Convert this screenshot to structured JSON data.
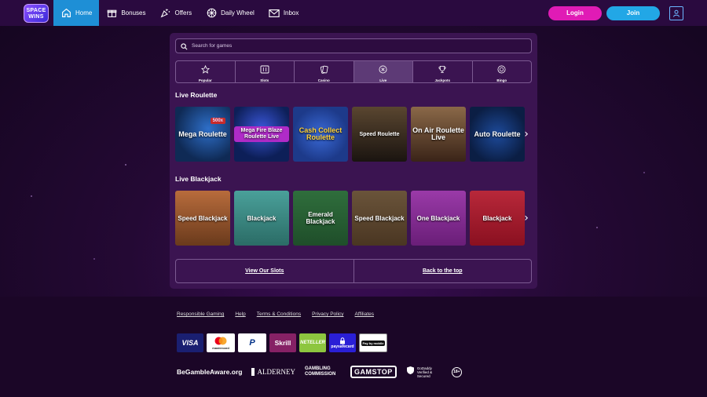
{
  "header": {
    "logo_text": "SPACE WINS",
    "nav": [
      {
        "label": "Home",
        "icon": "home-icon",
        "active": true
      },
      {
        "label": "Bonuses",
        "icon": "gift-icon",
        "active": false
      },
      {
        "label": "Offers",
        "icon": "party-popper-icon",
        "active": false
      },
      {
        "label": "Daily Wheel",
        "icon": "wheel-icon",
        "active": false
      },
      {
        "label": "Inbox",
        "icon": "mail-icon",
        "active": false
      }
    ],
    "login_label": "Login",
    "join_label": "Join"
  },
  "search": {
    "placeholder": "Search for games"
  },
  "categories": [
    {
      "label": "Popular",
      "icon": "star-icon",
      "active": false
    },
    {
      "label": "Slots",
      "icon": "slot-machine-icon",
      "active": false
    },
    {
      "label": "Casino",
      "icon": "cards-icon",
      "active": false
    },
    {
      "label": "Live",
      "icon": "live-chip-icon",
      "active": true
    },
    {
      "label": "Jackpots",
      "icon": "trophy-icon",
      "active": false
    },
    {
      "label": "Bingo",
      "icon": "bingo-ball-icon",
      "active": false
    }
  ],
  "sections": [
    {
      "title": "Live Roulette",
      "games": [
        {
          "name": "Mega Roulette",
          "badge": "500x",
          "color": "#0f2a55"
        },
        {
          "name": "Mega Fire Blaze Roulette Live",
          "color": "#0d1f58"
        },
        {
          "name": "Cash Collect Roulette",
          "color": "#1d3a8a"
        },
        {
          "name": "Speed Roulette",
          "color": "#1a1410"
        },
        {
          "name": "On Air Roulette Live",
          "color": "#3a2418"
        },
        {
          "name": "Auto Roulette",
          "color": "#0b1e44"
        }
      ]
    },
    {
      "title": "Live Blackjack",
      "games": [
        {
          "name": "Speed Blackjack",
          "color": "#6a3a1c"
        },
        {
          "name": "Blackjack",
          "color": "#2b6c66"
        },
        {
          "name": "Emerald Blackjack",
          "color": "#1f4e2a"
        },
        {
          "name": "Speed Blackjack",
          "color": "#4a3622"
        },
        {
          "name": "One Blackjack",
          "color": "#6a1e78"
        },
        {
          "name": "Blackjack",
          "color": "#8a1020"
        }
      ]
    }
  ],
  "bottom_links": {
    "view_slots": "View Our Slots",
    "back_top": "Back to the top"
  },
  "footer": {
    "links": [
      "Responsible Gaming",
      "Help",
      "Terms & Conditions",
      "Privacy Policy",
      "Affiliates"
    ],
    "payments": [
      "VISA",
      "mastercard",
      "PayPal",
      "Skrill",
      "NETELLER",
      "paysafecard",
      "Pay by mobile"
    ],
    "regulators": [
      "BeGambleAware.org",
      "ALDERNEY",
      "GAMBLING COMMISSION",
      "GAMSTOP",
      "GoDaddy Verified & Secured",
      "18+"
    ]
  }
}
